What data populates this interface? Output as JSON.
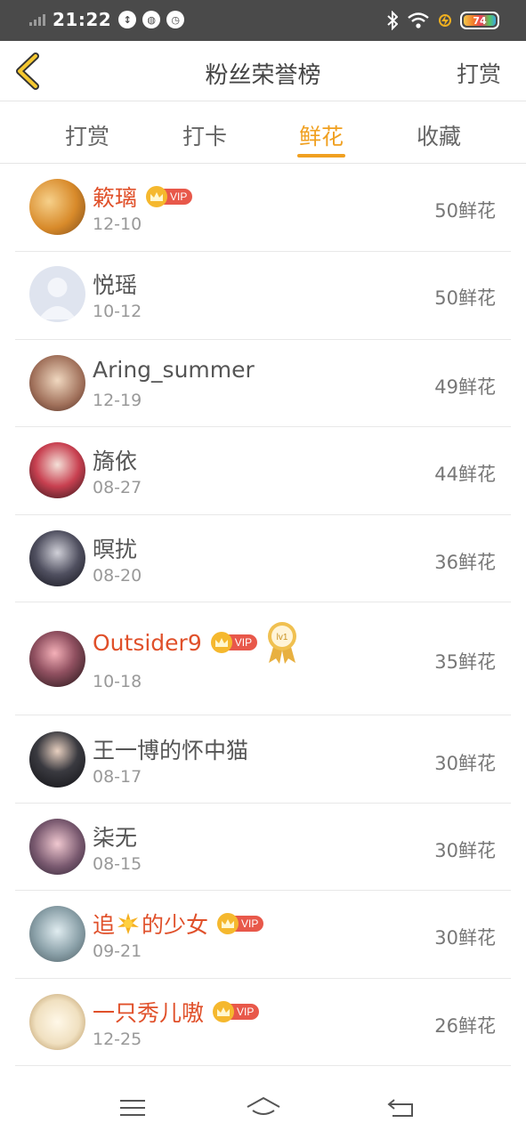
{
  "status_bar": {
    "time": "21:22",
    "battery": "74",
    "icons": [
      "signal-icon",
      "data-icon",
      "wechat-icon",
      "alarm-icon",
      "bluetooth-icon",
      "wifi-icon",
      "charging-icon",
      "battery-icon"
    ]
  },
  "header": {
    "title": "粉丝荣誉榜",
    "right_action": "打赏",
    "back_icon": "chevron-left-icon"
  },
  "tabs": [
    {
      "label": "打赏",
      "active": false
    },
    {
      "label": "打卡",
      "active": false
    },
    {
      "label": "鲜花",
      "active": true
    },
    {
      "label": "收藏",
      "active": false
    }
  ],
  "fans": [
    {
      "name": "簌璃",
      "date": "12-10",
      "count": "50鲜花",
      "vip": true
    },
    {
      "name": "悦瑶",
      "date": "10-12",
      "count": "50鲜花",
      "vip": false
    },
    {
      "name": "Aring_summer",
      "date": "12-19",
      "count": "49鲜花",
      "vip": false
    },
    {
      "name": "旖依",
      "date": "08-27",
      "count": "44鲜花",
      "vip": false
    },
    {
      "name": "暝扰",
      "date": "08-20",
      "count": "36鲜花",
      "vip": false
    },
    {
      "name": "Outsider9",
      "date": "10-18",
      "count": "35鲜花",
      "vip": true,
      "level_badge": "lv1"
    },
    {
      "name": "王一博的怀中猫",
      "date": "08-17",
      "count": "30鲜花",
      "vip": false
    },
    {
      "name": "柒无",
      "date": "08-15",
      "count": "30鲜花",
      "vip": false
    },
    {
      "name_before": "追",
      "name_after": "的少女",
      "date": "09-21",
      "count": "30鲜花",
      "vip": true
    },
    {
      "name": "一只秀儿嗷",
      "date": "12-25",
      "count": "26鲜花",
      "vip": true
    }
  ],
  "vip_label": "VIP",
  "colors": {
    "accent": "#f0a020",
    "vip_name": "#e0502a",
    "status_bar": "#4a4a4a"
  },
  "nav": [
    "menu-icon",
    "home-icon",
    "back-arrow-icon"
  ]
}
